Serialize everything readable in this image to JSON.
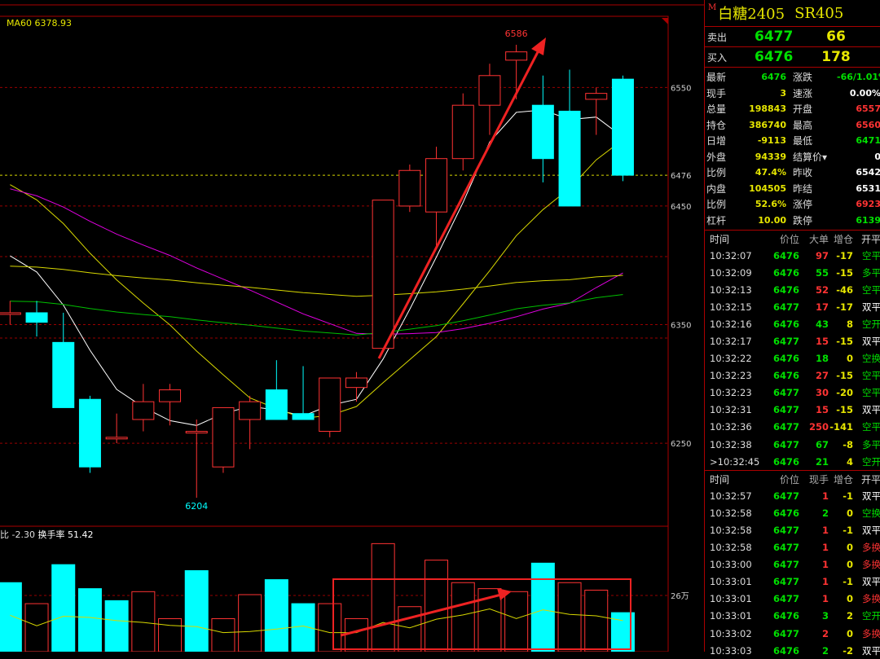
{
  "chart": {
    "ma_label": "MA60 6378.93",
    "vol_label_prefix": "比 -2.30",
    "vol_label_turnover": "换手率 51.42",
    "price_labels": [
      "6550",
      "6476",
      "6450",
      "6350",
      "6250"
    ],
    "vol_axis_label": "26万",
    "high_annotation": "6586",
    "low_annotation": "6204"
  },
  "chart_data": {
    "type": "candlestick",
    "ylim": [
      6180,
      6610
    ],
    "candles": [
      {
        "o": 6360,
        "h": 6370,
        "l": 6350,
        "c": 6360
      },
      {
        "o": 6360,
        "h": 6370,
        "l": 6340,
        "c": 6352
      },
      {
        "o": 6335,
        "h": 6360,
        "l": 6280,
        "c": 6280
      },
      {
        "o": 6287,
        "h": 6290,
        "l": 6225,
        "c": 6230
      },
      {
        "o": 6255,
        "h": 6275,
        "l": 6250,
        "c": 6255
      },
      {
        "o": 6270,
        "h": 6300,
        "l": 6260,
        "c": 6285
      },
      {
        "o": 6285,
        "h": 6300,
        "l": 6265,
        "c": 6295
      },
      {
        "o": 6260,
        "h": 6270,
        "l": 6204,
        "c": 6260
      },
      {
        "o": 6230,
        "h": 6280,
        "l": 6225,
        "c": 6280
      },
      {
        "o": 6270,
        "h": 6290,
        "l": 6245,
        "c": 6285
      },
      {
        "o": 6295,
        "h": 6320,
        "l": 6270,
        "c": 6270
      },
      {
        "o": 6275,
        "h": 6315,
        "l": 6270,
        "c": 6270
      },
      {
        "o": 6260,
        "h": 6305,
        "l": 6255,
        "c": 6305
      },
      {
        "o": 6297,
        "h": 6310,
        "l": 6285,
        "c": 6305
      },
      {
        "o": 6330,
        "h": 6455,
        "l": 6330,
        "c": 6455
      },
      {
        "o": 6450,
        "h": 6485,
        "l": 6445,
        "c": 6480
      },
      {
        "o": 6445,
        "h": 6500,
        "l": 6415,
        "c": 6490
      },
      {
        "o": 6490,
        "h": 6545,
        "l": 6480,
        "c": 6535
      },
      {
        "o": 6535,
        "h": 6570,
        "l": 6510,
        "c": 6560
      },
      {
        "o": 6573,
        "h": 6586,
        "l": 6540,
        "c": 6580
      },
      {
        "o": 6535,
        "h": 6560,
        "l": 6470,
        "c": 6490
      },
      {
        "o": 6530,
        "h": 6565,
        "l": 6450,
        "c": 6450
      },
      {
        "o": 6540,
        "h": 6550,
        "l": 6510,
        "c": 6545
      },
      {
        "o": 6557,
        "h": 6560,
        "l": 6471,
        "c": 6476
      }
    ],
    "volume_ylim": [
      0,
      380000
    ],
    "volumes": [
      {
        "v": 230000,
        "up": false
      },
      {
        "v": 160000,
        "up": true
      },
      {
        "v": 290000,
        "up": false
      },
      {
        "v": 210000,
        "up": false
      },
      {
        "v": 170000,
        "up": false
      },
      {
        "v": 200000,
        "up": true
      },
      {
        "v": 110000,
        "up": true
      },
      {
        "v": 270000,
        "up": false
      },
      {
        "v": 110000,
        "up": true
      },
      {
        "v": 190000,
        "up": true
      },
      {
        "v": 240000,
        "up": false
      },
      {
        "v": 160000,
        "up": false
      },
      {
        "v": 160000,
        "up": true
      },
      {
        "v": 110000,
        "up": true
      },
      {
        "v": 360000,
        "up": true
      },
      {
        "v": 150000,
        "up": true
      },
      {
        "v": 305000,
        "up": true
      },
      {
        "v": 230000,
        "up": true
      },
      {
        "v": 210000,
        "up": true
      },
      {
        "v": 200000,
        "up": true
      },
      {
        "v": 295000,
        "up": false
      },
      {
        "v": 230000,
        "up": true
      },
      {
        "v": 205000,
        "up": true
      },
      {
        "v": 130000,
        "up": false
      }
    ]
  },
  "sidebar": {
    "m_badge": "M",
    "symbol_name": "白糖2405",
    "symbol_code": "SR405",
    "ask": {
      "label": "卖出",
      "price": "6477",
      "volume": "66"
    },
    "bid": {
      "label": "买入",
      "price": "6476",
      "volume": "178"
    },
    "stats": [
      {
        "k1": "最新",
        "v1": "6476",
        "c1": "grn",
        "k2": "涨跌",
        "v2": "-66/1.01%",
        "c2": "grn"
      },
      {
        "k1": "现手",
        "v1": "3",
        "c1": "yel",
        "k2": "速涨",
        "v2": "0.00%",
        "c2": "wht"
      },
      {
        "k1": "总量",
        "v1": "198843",
        "c1": "yel",
        "k2": "开盘",
        "v2": "6557",
        "c2": "red"
      },
      {
        "k1": "持仓",
        "v1": "386740",
        "c1": "yel",
        "k2": "最高",
        "v2": "6560",
        "c2": "red"
      },
      {
        "k1": "日增",
        "v1": "-9113",
        "c1": "yel",
        "k2": "最低",
        "v2": "6471",
        "c2": "grn"
      },
      {
        "k1": "外盘",
        "v1": "94339",
        "c1": "yel",
        "k2": "结算价▾",
        "v2": "0",
        "c2": "wht"
      },
      {
        "k1": "比例",
        "v1": "47.4%",
        "c1": "yel",
        "k2": "昨收",
        "v2": "6542",
        "c2": "wht"
      },
      {
        "k1": "内盘",
        "v1": "104505",
        "c1": "yel",
        "k2": "昨结",
        "v2": "6531",
        "c2": "wht"
      },
      {
        "k1": "比例",
        "v1": "52.6%",
        "c1": "yel",
        "k2": "涨停",
        "v2": "6923",
        "c2": "red"
      },
      {
        "k1": "杠杆",
        "v1": "10.00",
        "c1": "yel",
        "k2": "跌停",
        "v2": "6139",
        "c2": "grn"
      }
    ],
    "ticks1": {
      "headers": [
        "时间",
        "价位",
        "大单",
        "增仓",
        "开平"
      ],
      "rows": [
        {
          "t": "10:32:07",
          "p": "6476",
          "v": "97",
          "vc": "red",
          "d": "-17",
          "o": "空平",
          "oc": "grn"
        },
        {
          "t": "10:32:09",
          "p": "6476",
          "v": "55",
          "vc": "grn",
          "d": "-15",
          "o": "多平",
          "oc": "grn"
        },
        {
          "t": "10:32:13",
          "p": "6476",
          "v": "52",
          "vc": "red",
          "d": "-46",
          "o": "空平",
          "oc": "grn"
        },
        {
          "t": "10:32:15",
          "p": "6477",
          "v": "17",
          "vc": "red",
          "d": "-17",
          "o": "双平",
          "oc": "wht"
        },
        {
          "t": "10:32:16",
          "p": "6476",
          "v": "43",
          "vc": "grn",
          "d": "8",
          "o": "空开",
          "oc": "grn"
        },
        {
          "t": "10:32:17",
          "p": "6477",
          "v": "15",
          "vc": "red",
          "d": "-15",
          "o": "双平",
          "oc": "wht"
        },
        {
          "t": "10:32:22",
          "p": "6476",
          "v": "18",
          "vc": "grn",
          "d": "0",
          "o": "空换",
          "oc": "grn"
        },
        {
          "t": "10:32:23",
          "p": "6476",
          "v": "27",
          "vc": "red",
          "d": "-15",
          "o": "空平",
          "oc": "grn"
        },
        {
          "t": "10:32:23",
          "p": "6477",
          "v": "30",
          "vc": "red",
          "d": "-20",
          "o": "空平",
          "oc": "grn"
        },
        {
          "t": "10:32:31",
          "p": "6477",
          "v": "15",
          "vc": "red",
          "d": "-15",
          "o": "双平",
          "oc": "wht"
        },
        {
          "t": "10:32:36",
          "p": "6477",
          "v": "250",
          "vc": "red",
          "d": "-141",
          "o": "空平",
          "oc": "grn"
        },
        {
          "t": "10:32:38",
          "p": "6477",
          "v": "67",
          "vc": "grn",
          "d": "-8",
          "o": "多平",
          "oc": "grn"
        },
        {
          "t": ">10:32:45",
          "p": "6476",
          "v": "21",
          "vc": "grn",
          "d": "4",
          "o": "空开",
          "oc": "grn"
        }
      ]
    },
    "ticks2": {
      "headers": [
        "时间",
        "价位",
        "现手",
        "增仓",
        "开平"
      ],
      "rows": [
        {
          "t": "10:32:57",
          "p": "6477",
          "v": "1",
          "vc": "red",
          "d": "-1",
          "o": "双平",
          "oc": "wht"
        },
        {
          "t": "10:32:58",
          "p": "6476",
          "v": "2",
          "vc": "grn",
          "d": "0",
          "o": "空换",
          "oc": "grn"
        },
        {
          "t": "10:32:58",
          "p": "6477",
          "v": "1",
          "vc": "red",
          "d": "-1",
          "o": "双平",
          "oc": "wht"
        },
        {
          "t": "10:32:58",
          "p": "6477",
          "v": "1",
          "vc": "red",
          "d": "0",
          "o": "多换",
          "oc": "red"
        },
        {
          "t": "10:33:00",
          "p": "6477",
          "v": "1",
          "vc": "red",
          "d": "0",
          "o": "多换",
          "oc": "red"
        },
        {
          "t": "10:33:01",
          "p": "6477",
          "v": "1",
          "vc": "red",
          "d": "-1",
          "o": "双平",
          "oc": "wht"
        },
        {
          "t": "10:33:01",
          "p": "6477",
          "v": "1",
          "vc": "red",
          "d": "0",
          "o": "多换",
          "oc": "red"
        },
        {
          "t": "10:33:01",
          "p": "6476",
          "v": "3",
          "vc": "grn",
          "d": "2",
          "o": "空开",
          "oc": "grn"
        },
        {
          "t": "10:33:02",
          "p": "6477",
          "v": "2",
          "vc": "red",
          "d": "0",
          "o": "多换",
          "oc": "red"
        },
        {
          "t": "10:33:03",
          "p": "6476",
          "v": "2",
          "vc": "grn",
          "d": "-2",
          "o": "双平",
          "oc": "wht"
        }
      ]
    }
  }
}
